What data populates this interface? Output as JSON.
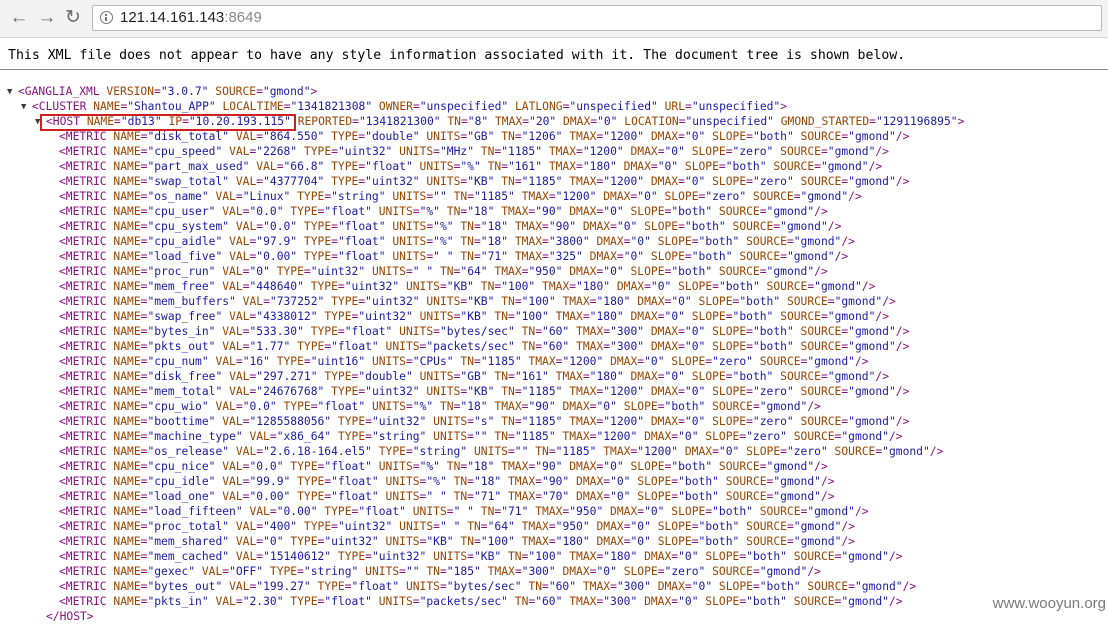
{
  "browser": {
    "back_icon": "back-arrow-icon",
    "forward_icon": "forward-arrow-icon",
    "reload_icon": "reload-icon",
    "url_host": "121.14.161.143",
    "url_port": ":8649"
  },
  "notice": "This XML file does not appear to have any style information associated with it. The document tree is shown below.",
  "tree": {
    "root": {
      "tag": "GANGLIA_XML",
      "attrs": [
        [
          "VERSION",
          "3.0.7"
        ],
        [
          "SOURCE",
          "gmond"
        ]
      ]
    },
    "cluster": {
      "tag": "CLUSTER",
      "attrs": [
        [
          "NAME",
          "Shantou_APP"
        ],
        [
          "LOCALTIME",
          "1341821308"
        ],
        [
          "OWNER",
          "unspecified"
        ],
        [
          "LATLONG",
          "unspecified"
        ],
        [
          "URL",
          "unspecified"
        ]
      ]
    },
    "host": {
      "tag": "HOST",
      "attrs": [
        [
          "NAME",
          "db13"
        ],
        [
          "IP",
          "10.20.193.115"
        ],
        [
          "REPORTED",
          "1341821300"
        ],
        [
          "TN",
          "8"
        ],
        [
          "TMAX",
          "20"
        ],
        [
          "DMAX",
          "0"
        ],
        [
          "LOCATION",
          "unspecified"
        ],
        [
          "GMOND_STARTED",
          "1291196895"
        ]
      ]
    },
    "metrics": [
      [
        [
          "NAME",
          "disk_total"
        ],
        [
          "VAL",
          "864.550"
        ],
        [
          "TYPE",
          "double"
        ],
        [
          "UNITS",
          "GB"
        ],
        [
          "TN",
          "1206"
        ],
        [
          "TMAX",
          "1200"
        ],
        [
          "DMAX",
          "0"
        ],
        [
          "SLOPE",
          "both"
        ],
        [
          "SOURCE",
          "gmond"
        ]
      ],
      [
        [
          "NAME",
          "cpu_speed"
        ],
        [
          "VAL",
          "2268"
        ],
        [
          "TYPE",
          "uint32"
        ],
        [
          "UNITS",
          "MHz"
        ],
        [
          "TN",
          "1185"
        ],
        [
          "TMAX",
          "1200"
        ],
        [
          "DMAX",
          "0"
        ],
        [
          "SLOPE",
          "zero"
        ],
        [
          "SOURCE",
          "gmond"
        ]
      ],
      [
        [
          "NAME",
          "part_max_used"
        ],
        [
          "VAL",
          "66.8"
        ],
        [
          "TYPE",
          "float"
        ],
        [
          "UNITS",
          "%"
        ],
        [
          "TN",
          "161"
        ],
        [
          "TMAX",
          "180"
        ],
        [
          "DMAX",
          "0"
        ],
        [
          "SLOPE",
          "both"
        ],
        [
          "SOURCE",
          "gmond"
        ]
      ],
      [
        [
          "NAME",
          "swap_total"
        ],
        [
          "VAL",
          "4377704"
        ],
        [
          "TYPE",
          "uint32"
        ],
        [
          "UNITS",
          "KB"
        ],
        [
          "TN",
          "1185"
        ],
        [
          "TMAX",
          "1200"
        ],
        [
          "DMAX",
          "0"
        ],
        [
          "SLOPE",
          "zero"
        ],
        [
          "SOURCE",
          "gmond"
        ]
      ],
      [
        [
          "NAME",
          "os_name"
        ],
        [
          "VAL",
          "Linux"
        ],
        [
          "TYPE",
          "string"
        ],
        [
          "UNITS",
          ""
        ],
        [
          "TN",
          "1185"
        ],
        [
          "TMAX",
          "1200"
        ],
        [
          "DMAX",
          "0"
        ],
        [
          "SLOPE",
          "zero"
        ],
        [
          "SOURCE",
          "gmond"
        ]
      ],
      [
        [
          "NAME",
          "cpu_user"
        ],
        [
          "VAL",
          "0.0"
        ],
        [
          "TYPE",
          "float"
        ],
        [
          "UNITS",
          "%"
        ],
        [
          "TN",
          "18"
        ],
        [
          "TMAX",
          "90"
        ],
        [
          "DMAX",
          "0"
        ],
        [
          "SLOPE",
          "both"
        ],
        [
          "SOURCE",
          "gmond"
        ]
      ],
      [
        [
          "NAME",
          "cpu_system"
        ],
        [
          "VAL",
          "0.0"
        ],
        [
          "TYPE",
          "float"
        ],
        [
          "UNITS",
          "%"
        ],
        [
          "TN",
          "18"
        ],
        [
          "TMAX",
          "90"
        ],
        [
          "DMAX",
          "0"
        ],
        [
          "SLOPE",
          "both"
        ],
        [
          "SOURCE",
          "gmond"
        ]
      ],
      [
        [
          "NAME",
          "cpu_aidle"
        ],
        [
          "VAL",
          "97.9"
        ],
        [
          "TYPE",
          "float"
        ],
        [
          "UNITS",
          "%"
        ],
        [
          "TN",
          "18"
        ],
        [
          "TMAX",
          "3800"
        ],
        [
          "DMAX",
          "0"
        ],
        [
          "SLOPE",
          "both"
        ],
        [
          "SOURCE",
          "gmond"
        ]
      ],
      [
        [
          "NAME",
          "load_five"
        ],
        [
          "VAL",
          "0.00"
        ],
        [
          "TYPE",
          "float"
        ],
        [
          "UNITS",
          " "
        ],
        [
          "TN",
          "71"
        ],
        [
          "TMAX",
          "325"
        ],
        [
          "DMAX",
          "0"
        ],
        [
          "SLOPE",
          "both"
        ],
        [
          "SOURCE",
          "gmond"
        ]
      ],
      [
        [
          "NAME",
          "proc_run"
        ],
        [
          "VAL",
          "0"
        ],
        [
          "TYPE",
          "uint32"
        ],
        [
          "UNITS",
          " "
        ],
        [
          "TN",
          "64"
        ],
        [
          "TMAX",
          "950"
        ],
        [
          "DMAX",
          "0"
        ],
        [
          "SLOPE",
          "both"
        ],
        [
          "SOURCE",
          "gmond"
        ]
      ],
      [
        [
          "NAME",
          "mem_free"
        ],
        [
          "VAL",
          "448640"
        ],
        [
          "TYPE",
          "uint32"
        ],
        [
          "UNITS",
          "KB"
        ],
        [
          "TN",
          "100"
        ],
        [
          "TMAX",
          "180"
        ],
        [
          "DMAX",
          "0"
        ],
        [
          "SLOPE",
          "both"
        ],
        [
          "SOURCE",
          "gmond"
        ]
      ],
      [
        [
          "NAME",
          "mem_buffers"
        ],
        [
          "VAL",
          "737252"
        ],
        [
          "TYPE",
          "uint32"
        ],
        [
          "UNITS",
          "KB"
        ],
        [
          "TN",
          "100"
        ],
        [
          "TMAX",
          "180"
        ],
        [
          "DMAX",
          "0"
        ],
        [
          "SLOPE",
          "both"
        ],
        [
          "SOURCE",
          "gmond"
        ]
      ],
      [
        [
          "NAME",
          "swap_free"
        ],
        [
          "VAL",
          "4338012"
        ],
        [
          "TYPE",
          "uint32"
        ],
        [
          "UNITS",
          "KB"
        ],
        [
          "TN",
          "100"
        ],
        [
          "TMAX",
          "180"
        ],
        [
          "DMAX",
          "0"
        ],
        [
          "SLOPE",
          "both"
        ],
        [
          "SOURCE",
          "gmond"
        ]
      ],
      [
        [
          "NAME",
          "bytes_in"
        ],
        [
          "VAL",
          "533.30"
        ],
        [
          "TYPE",
          "float"
        ],
        [
          "UNITS",
          "bytes/sec"
        ],
        [
          "TN",
          "60"
        ],
        [
          "TMAX",
          "300"
        ],
        [
          "DMAX",
          "0"
        ],
        [
          "SLOPE",
          "both"
        ],
        [
          "SOURCE",
          "gmond"
        ]
      ],
      [
        [
          "NAME",
          "pkts_out"
        ],
        [
          "VAL",
          "1.77"
        ],
        [
          "TYPE",
          "float"
        ],
        [
          "UNITS",
          "packets/sec"
        ],
        [
          "TN",
          "60"
        ],
        [
          "TMAX",
          "300"
        ],
        [
          "DMAX",
          "0"
        ],
        [
          "SLOPE",
          "both"
        ],
        [
          "SOURCE",
          "gmond"
        ]
      ],
      [
        [
          "NAME",
          "cpu_num"
        ],
        [
          "VAL",
          "16"
        ],
        [
          "TYPE",
          "uint16"
        ],
        [
          "UNITS",
          "CPUs"
        ],
        [
          "TN",
          "1185"
        ],
        [
          "TMAX",
          "1200"
        ],
        [
          "DMAX",
          "0"
        ],
        [
          "SLOPE",
          "zero"
        ],
        [
          "SOURCE",
          "gmond"
        ]
      ],
      [
        [
          "NAME",
          "disk_free"
        ],
        [
          "VAL",
          "297.271"
        ],
        [
          "TYPE",
          "double"
        ],
        [
          "UNITS",
          "GB"
        ],
        [
          "TN",
          "161"
        ],
        [
          "TMAX",
          "180"
        ],
        [
          "DMAX",
          "0"
        ],
        [
          "SLOPE",
          "both"
        ],
        [
          "SOURCE",
          "gmond"
        ]
      ],
      [
        [
          "NAME",
          "mem_total"
        ],
        [
          "VAL",
          "24676768"
        ],
        [
          "TYPE",
          "uint32"
        ],
        [
          "UNITS",
          "KB"
        ],
        [
          "TN",
          "1185"
        ],
        [
          "TMAX",
          "1200"
        ],
        [
          "DMAX",
          "0"
        ],
        [
          "SLOPE",
          "zero"
        ],
        [
          "SOURCE",
          "gmond"
        ]
      ],
      [
        [
          "NAME",
          "cpu_wio"
        ],
        [
          "VAL",
          "0.0"
        ],
        [
          "TYPE",
          "float"
        ],
        [
          "UNITS",
          "%"
        ],
        [
          "TN",
          "18"
        ],
        [
          "TMAX",
          "90"
        ],
        [
          "DMAX",
          "0"
        ],
        [
          "SLOPE",
          "both"
        ],
        [
          "SOURCE",
          "gmond"
        ]
      ],
      [
        [
          "NAME",
          "boottime"
        ],
        [
          "VAL",
          "1285588056"
        ],
        [
          "TYPE",
          "uint32"
        ],
        [
          "UNITS",
          "s"
        ],
        [
          "TN",
          "1185"
        ],
        [
          "TMAX",
          "1200"
        ],
        [
          "DMAX",
          "0"
        ],
        [
          "SLOPE",
          "zero"
        ],
        [
          "SOURCE",
          "gmond"
        ]
      ],
      [
        [
          "NAME",
          "machine_type"
        ],
        [
          "VAL",
          "x86_64"
        ],
        [
          "TYPE",
          "string"
        ],
        [
          "UNITS",
          ""
        ],
        [
          "TN",
          "1185"
        ],
        [
          "TMAX",
          "1200"
        ],
        [
          "DMAX",
          "0"
        ],
        [
          "SLOPE",
          "zero"
        ],
        [
          "SOURCE",
          "gmond"
        ]
      ],
      [
        [
          "NAME",
          "os_release"
        ],
        [
          "VAL",
          "2.6.18-164.el5"
        ],
        [
          "TYPE",
          "string"
        ],
        [
          "UNITS",
          ""
        ],
        [
          "TN",
          "1185"
        ],
        [
          "TMAX",
          "1200"
        ],
        [
          "DMAX",
          "0"
        ],
        [
          "SLOPE",
          "zero"
        ],
        [
          "SOURCE",
          "gmond"
        ]
      ],
      [
        [
          "NAME",
          "cpu_nice"
        ],
        [
          "VAL",
          "0.0"
        ],
        [
          "TYPE",
          "float"
        ],
        [
          "UNITS",
          "%"
        ],
        [
          "TN",
          "18"
        ],
        [
          "TMAX",
          "90"
        ],
        [
          "DMAX",
          "0"
        ],
        [
          "SLOPE",
          "both"
        ],
        [
          "SOURCE",
          "gmond"
        ]
      ],
      [
        [
          "NAME",
          "cpu_idle"
        ],
        [
          "VAL",
          "99.9"
        ],
        [
          "TYPE",
          "float"
        ],
        [
          "UNITS",
          "%"
        ],
        [
          "TN",
          "18"
        ],
        [
          "TMAX",
          "90"
        ],
        [
          "DMAX",
          "0"
        ],
        [
          "SLOPE",
          "both"
        ],
        [
          "SOURCE",
          "gmond"
        ]
      ],
      [
        [
          "NAME",
          "load_one"
        ],
        [
          "VAL",
          "0.00"
        ],
        [
          "TYPE",
          "float"
        ],
        [
          "UNITS",
          " "
        ],
        [
          "TN",
          "71"
        ],
        [
          "TMAX",
          "70"
        ],
        [
          "DMAX",
          "0"
        ],
        [
          "SLOPE",
          "both"
        ],
        [
          "SOURCE",
          "gmond"
        ]
      ],
      [
        [
          "NAME",
          "load_fifteen"
        ],
        [
          "VAL",
          "0.00"
        ],
        [
          "TYPE",
          "float"
        ],
        [
          "UNITS",
          " "
        ],
        [
          "TN",
          "71"
        ],
        [
          "TMAX",
          "950"
        ],
        [
          "DMAX",
          "0"
        ],
        [
          "SLOPE",
          "both"
        ],
        [
          "SOURCE",
          "gmond"
        ]
      ],
      [
        [
          "NAME",
          "proc_total"
        ],
        [
          "VAL",
          "400"
        ],
        [
          "TYPE",
          "uint32"
        ],
        [
          "UNITS",
          " "
        ],
        [
          "TN",
          "64"
        ],
        [
          "TMAX",
          "950"
        ],
        [
          "DMAX",
          "0"
        ],
        [
          "SLOPE",
          "both"
        ],
        [
          "SOURCE",
          "gmond"
        ]
      ],
      [
        [
          "NAME",
          "mem_shared"
        ],
        [
          "VAL",
          "0"
        ],
        [
          "TYPE",
          "uint32"
        ],
        [
          "UNITS",
          "KB"
        ],
        [
          "TN",
          "100"
        ],
        [
          "TMAX",
          "180"
        ],
        [
          "DMAX",
          "0"
        ],
        [
          "SLOPE",
          "both"
        ],
        [
          "SOURCE",
          "gmond"
        ]
      ],
      [
        [
          "NAME",
          "mem_cached"
        ],
        [
          "VAL",
          "15140612"
        ],
        [
          "TYPE",
          "uint32"
        ],
        [
          "UNITS",
          "KB"
        ],
        [
          "TN",
          "100"
        ],
        [
          "TMAX",
          "180"
        ],
        [
          "DMAX",
          "0"
        ],
        [
          "SLOPE",
          "both"
        ],
        [
          "SOURCE",
          "gmond"
        ]
      ],
      [
        [
          "NAME",
          "gexec"
        ],
        [
          "VAL",
          "OFF"
        ],
        [
          "TYPE",
          "string"
        ],
        [
          "UNITS",
          ""
        ],
        [
          "TN",
          "185"
        ],
        [
          "TMAX",
          "300"
        ],
        [
          "DMAX",
          "0"
        ],
        [
          "SLOPE",
          "zero"
        ],
        [
          "SOURCE",
          "gmond"
        ]
      ],
      [
        [
          "NAME",
          "bytes_out"
        ],
        [
          "VAL",
          "199.27"
        ],
        [
          "TYPE",
          "float"
        ],
        [
          "UNITS",
          "bytes/sec"
        ],
        [
          "TN",
          "60"
        ],
        [
          "TMAX",
          "300"
        ],
        [
          "DMAX",
          "0"
        ],
        [
          "SLOPE",
          "both"
        ],
        [
          "SOURCE",
          "gmond"
        ]
      ],
      [
        [
          "NAME",
          "pkts_in"
        ],
        [
          "VAL",
          "2.30"
        ],
        [
          "TYPE",
          "float"
        ],
        [
          "UNITS",
          "packets/sec"
        ],
        [
          "TN",
          "60"
        ],
        [
          "TMAX",
          "300"
        ],
        [
          "DMAX",
          "0"
        ],
        [
          "SLOPE",
          "both"
        ],
        [
          "SOURCE",
          "gmond"
        ]
      ]
    ],
    "host_close": "</HOST>"
  },
  "watermark": "www.wooyun.org"
}
